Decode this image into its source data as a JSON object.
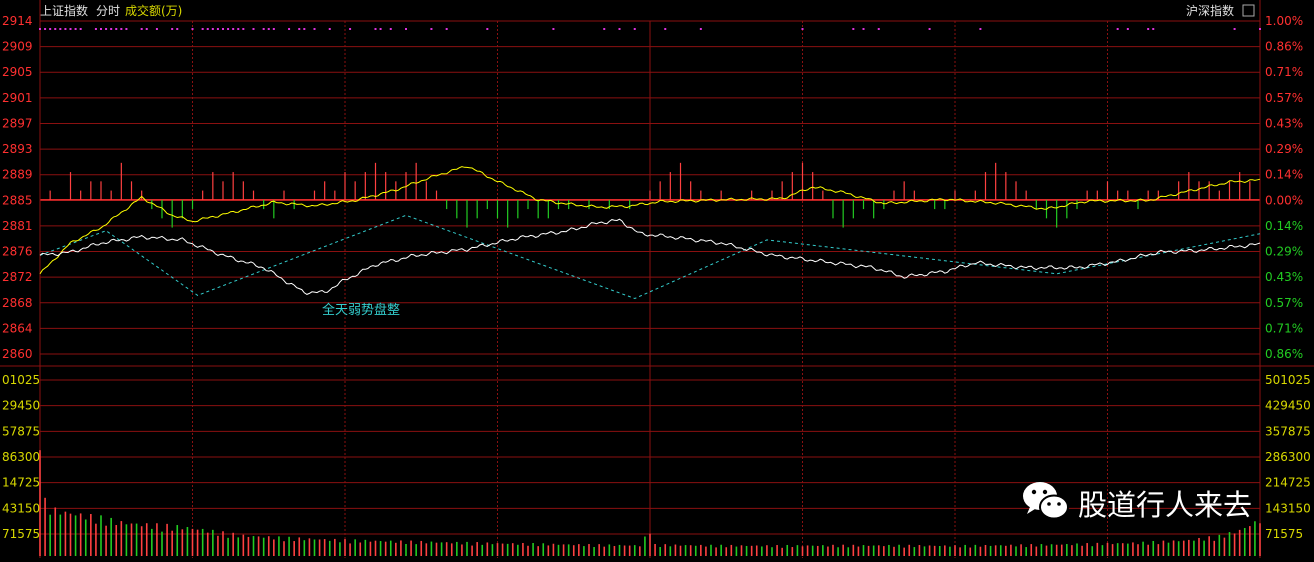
{
  "header": {
    "index_name": "上证指数",
    "mode": "分时",
    "volume_title": "成交额(万)",
    "compare_label": "沪深指数",
    "compare_checkbox": "unchecked"
  },
  "annotation": "全天弱势盘整",
  "watermark": "股道行人来去",
  "colors": {
    "background": "#000000",
    "grid": "#8a1010",
    "price_line": "#ffffff",
    "avg_line": "#ffff00",
    "up": "#ff4040",
    "down": "#22cc22",
    "trend": "#33cccc",
    "left_labels": "#ff3030",
    "right_labels": "#ff3030",
    "right_labels_down": "#22cc22",
    "volume_labels": "#d8d800",
    "event_dots": "#dd33dd"
  },
  "chart_data": [
    {
      "type": "line",
      "name": "intraday-price",
      "ylim": [
        2860,
        2914
      ],
      "base": 2885,
      "y_ticks_left": [
        "2914",
        "2909",
        "2905",
        "2901",
        "2897",
        "2893",
        "2889",
        "2885",
        "2881",
        "2876",
        "2872",
        "2868",
        "2864",
        "2860"
      ],
      "y_ticks_right": [
        "1.00%",
        "0.86%",
        "0.71%",
        "0.57%",
        "0.43%",
        "0.29%",
        "0.14%",
        "0.00%",
        "0.14%",
        "0.29%",
        "0.43%",
        "0.57%",
        "0.71%",
        "0.86%"
      ],
      "x_time_index_max": 240,
      "price_keypoints": [
        [
          0,
          2876
        ],
        [
          6,
          2876.5
        ],
        [
          12,
          2878
        ],
        [
          20,
          2879
        ],
        [
          28,
          2878.5
        ],
        [
          36,
          2876
        ],
        [
          44,
          2874
        ],
        [
          52,
          2870
        ],
        [
          56,
          2870
        ],
        [
          60,
          2872
        ],
        [
          66,
          2874.5
        ],
        [
          74,
          2876
        ],
        [
          84,
          2877
        ],
        [
          94,
          2878.8
        ],
        [
          104,
          2880
        ],
        [
          110,
          2881.3
        ],
        [
          114,
          2881.7
        ],
        [
          118,
          2879.5
        ],
        [
          124,
          2879
        ],
        [
          134,
          2878
        ],
        [
          144,
          2876
        ],
        [
          154,
          2875
        ],
        [
          164,
          2874
        ],
        [
          170,
          2872.5
        ],
        [
          178,
          2873.4
        ],
        [
          184,
          2874.8
        ],
        [
          194,
          2874
        ],
        [
          204,
          2874
        ],
        [
          212,
          2875
        ],
        [
          220,
          2876.5
        ],
        [
          228,
          2876.8
        ],
        [
          234,
          2877.3
        ],
        [
          240,
          2877.8
        ]
      ],
      "avg_keypoints": [
        [
          0,
          2873
        ],
        [
          6,
          2878
        ],
        [
          12,
          2880.5
        ],
        [
          20,
          2885.4
        ],
        [
          26,
          2882.5
        ],
        [
          30,
          2881.5
        ],
        [
          38,
          2883
        ],
        [
          46,
          2884.6
        ],
        [
          54,
          2884
        ],
        [
          62,
          2884.9
        ],
        [
          70,
          2886.6
        ],
        [
          76,
          2888.4
        ],
        [
          84,
          2890.5
        ],
        [
          90,
          2888
        ],
        [
          98,
          2885
        ],
        [
          104,
          2884.3
        ],
        [
          110,
          2883.8
        ],
        [
          116,
          2884
        ],
        [
          122,
          2884.7
        ],
        [
          134,
          2885
        ],
        [
          146,
          2885.2
        ],
        [
          152,
          2887.1
        ],
        [
          158,
          2886.2
        ],
        [
          166,
          2884.4
        ],
        [
          178,
          2885.1
        ],
        [
          188,
          2884.5
        ],
        [
          198,
          2883.5
        ],
        [
          206,
          2884.8
        ],
        [
          218,
          2884.9
        ],
        [
          228,
          2886.8
        ],
        [
          234,
          2887.9
        ],
        [
          240,
          2888.2
        ]
      ],
      "ratio_bars": [
        [
          2,
          1
        ],
        [
          6,
          3
        ],
        [
          8,
          1
        ],
        [
          10,
          2
        ],
        [
          12,
          2
        ],
        [
          14,
          1
        ],
        [
          16,
          4
        ],
        [
          18,
          2
        ],
        [
          20,
          1
        ],
        [
          22,
          -1
        ],
        [
          24,
          -2
        ],
        [
          26,
          -3
        ],
        [
          28,
          -2
        ],
        [
          30,
          -1
        ],
        [
          32,
          1
        ],
        [
          34,
          3
        ],
        [
          36,
          2
        ],
        [
          38,
          3
        ],
        [
          40,
          2
        ],
        [
          42,
          1
        ],
        [
          44,
          -1
        ],
        [
          46,
          -2
        ],
        [
          48,
          1
        ],
        [
          50,
          -1
        ],
        [
          54,
          1
        ],
        [
          56,
          2
        ],
        [
          58,
          1
        ],
        [
          60,
          3
        ],
        [
          62,
          2
        ],
        [
          64,
          3
        ],
        [
          66,
          4
        ],
        [
          68,
          3
        ],
        [
          70,
          2
        ],
        [
          72,
          3
        ],
        [
          74,
          4
        ],
        [
          76,
          2
        ],
        [
          78,
          1
        ],
        [
          80,
          -1
        ],
        [
          82,
          -2
        ],
        [
          84,
          -3
        ],
        [
          86,
          -2
        ],
        [
          88,
          -1
        ],
        [
          90,
          -2
        ],
        [
          92,
          -3
        ],
        [
          94,
          -2
        ],
        [
          96,
          -1
        ],
        [
          98,
          -2
        ],
        [
          100,
          -2
        ],
        [
          102,
          -1
        ],
        [
          104,
          -1
        ],
        [
          108,
          -1
        ],
        [
          112,
          -1
        ],
        [
          116,
          -1
        ],
        [
          120,
          1
        ],
        [
          122,
          2
        ],
        [
          124,
          3
        ],
        [
          126,
          4
        ],
        [
          128,
          2
        ],
        [
          130,
          1
        ],
        [
          134,
          1
        ],
        [
          140,
          1
        ],
        [
          144,
          1
        ],
        [
          146,
          2
        ],
        [
          148,
          3
        ],
        [
          150,
          4
        ],
        [
          152,
          3
        ],
        [
          154,
          1
        ],
        [
          156,
          -2
        ],
        [
          158,
          -3
        ],
        [
          160,
          -2
        ],
        [
          162,
          -1
        ],
        [
          164,
          -2
        ],
        [
          166,
          -1
        ],
        [
          168,
          1
        ],
        [
          170,
          2
        ],
        [
          172,
          1
        ],
        [
          176,
          -1
        ],
        [
          178,
          -1
        ],
        [
          180,
          1
        ],
        [
          184,
          1
        ],
        [
          186,
          3
        ],
        [
          188,
          4
        ],
        [
          190,
          3
        ],
        [
          192,
          2
        ],
        [
          194,
          1
        ],
        [
          196,
          -1
        ],
        [
          198,
          -2
        ],
        [
          200,
          -3
        ],
        [
          202,
          -2
        ],
        [
          204,
          -1
        ],
        [
          206,
          1
        ],
        [
          208,
          1
        ],
        [
          210,
          2
        ],
        [
          212,
          1
        ],
        [
          214,
          1
        ],
        [
          216,
          -1
        ],
        [
          218,
          1
        ],
        [
          220,
          1
        ],
        [
          224,
          2
        ],
        [
          226,
          3
        ],
        [
          228,
          2
        ],
        [
          230,
          2
        ],
        [
          232,
          1
        ],
        [
          234,
          2
        ],
        [
          236,
          3
        ],
        [
          238,
          2
        ]
      ],
      "trend_points": [
        [
          0,
          2876
        ],
        [
          13,
          2880
        ],
        [
          31,
          2869.5
        ],
        [
          72,
          2882.5
        ],
        [
          117,
          2869
        ],
        [
          143,
          2878.5
        ],
        [
          200,
          2873
        ],
        [
          240,
          2879.5
        ]
      ],
      "event_markers": [
        0,
        1,
        2,
        3,
        4,
        5,
        6,
        7,
        8,
        11,
        12,
        13,
        14,
        15,
        16,
        17,
        20,
        21,
        23,
        26,
        27,
        30,
        32,
        33,
        34,
        35,
        36,
        37,
        38,
        39,
        40,
        42,
        44,
        45,
        46,
        49,
        51,
        52,
        54,
        57,
        61,
        66,
        67,
        69,
        72,
        77,
        80,
        88,
        101,
        111,
        114,
        117,
        123,
        130,
        150,
        160,
        162,
        165,
        175,
        185,
        212,
        214,
        218,
        219,
        235,
        240
      ],
      "vertical_divider_times": [
        30,
        60,
        90,
        120,
        150,
        180,
        210
      ]
    },
    {
      "type": "bar",
      "name": "turnover",
      "ylim": [
        0,
        501025
      ],
      "y_ticks_left": [
        "01025",
        "29450",
        "57875",
        "86300",
        "14725",
        "43150",
        "71575"
      ],
      "y_ticks_right": [
        "501025",
        "429450",
        "357875",
        "286300",
        "214725",
        "143150",
        "71575"
      ],
      "volume_keypoints": [
        [
          0,
          405000
        ],
        [
          1,
          165000
        ],
        [
          2,
          145000
        ],
        [
          4,
          135000
        ],
        [
          8,
          125000
        ],
        [
          12,
          115000
        ],
        [
          16,
          102000
        ],
        [
          20,
          96000
        ],
        [
          24,
          92000
        ],
        [
          28,
          88000
        ],
        [
          32,
          80000
        ],
        [
          36,
          70000
        ],
        [
          40,
          62000
        ],
        [
          48,
          55000
        ],
        [
          60,
          48000
        ],
        [
          72,
          44000
        ],
        [
          84,
          40000
        ],
        [
          96,
          37000
        ],
        [
          108,
          34000
        ],
        [
          118,
          32000
        ],
        [
          120,
          80000
        ],
        [
          121,
          34000
        ],
        [
          132,
          32000
        ],
        [
          144,
          31000
        ],
        [
          156,
          32000
        ],
        [
          168,
          32000
        ],
        [
          180,
          31000
        ],
        [
          192,
          33000
        ],
        [
          204,
          36000
        ],
        [
          216,
          40000
        ],
        [
          226,
          48000
        ],
        [
          232,
          60000
        ],
        [
          236,
          78000
        ],
        [
          240,
          110000
        ]
      ]
    }
  ]
}
